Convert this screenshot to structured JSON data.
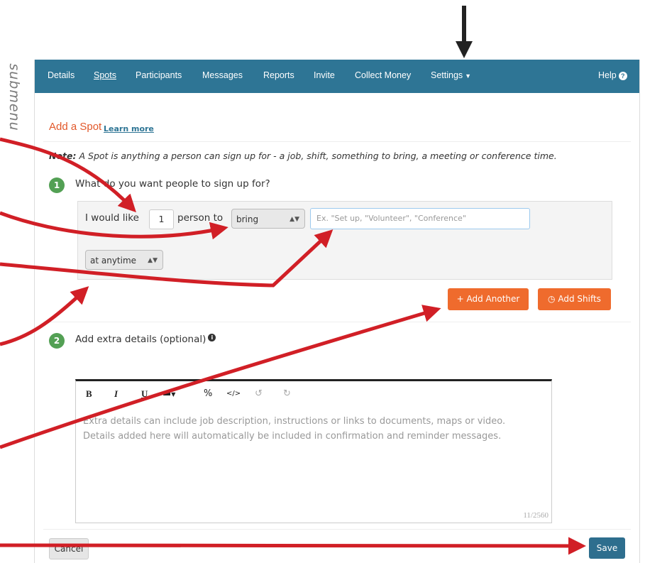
{
  "side_label": "submenu",
  "nav": {
    "items": [
      "Details",
      "Spots",
      "Participants",
      "Messages",
      "Reports",
      "Invite",
      "Collect Money",
      "Settings"
    ],
    "help": "Help"
  },
  "header": {
    "title": "Add a Spot",
    "learn_more": "Learn more"
  },
  "note": {
    "label": "Note:",
    "text": "A Spot is anything a person can sign up for - a job, shift, something to bring, a meeting or conference time."
  },
  "step1": {
    "number": "1",
    "label": "What do you want people to sign up for?",
    "prefix": "I would like",
    "quantity": "1",
    "middle": "person to",
    "action_select": "bring",
    "name_placeholder": "Ex. \"Set up, \"Volunteer\", \"Conference\"",
    "time_select": "at anytime"
  },
  "buttons": {
    "add_another": "+ Add Another",
    "add_shifts": "Add Shifts",
    "cancel": "Cancel",
    "save": "Save"
  },
  "step2": {
    "number": "2",
    "label": "Add extra details (optional)"
  },
  "editor": {
    "placeholder_line1": "Extra details can include job description, instructions or links to documents, maps or video.",
    "placeholder_line2": "Details added here will automatically be included in confirmation and reminder messages.",
    "counter": "11/2560",
    "toolbar": {
      "bold": "B",
      "italic": "I",
      "underline": "U",
      "undo": "↺",
      "redo": "↻"
    }
  },
  "colors": {
    "nav": "#2e7595",
    "accent_orange": "#ef6b2d",
    "title_orange": "#e2582a",
    "step_green": "#53a054",
    "annotation_red": "#d11f26",
    "save_blue": "#2e6e8e"
  }
}
